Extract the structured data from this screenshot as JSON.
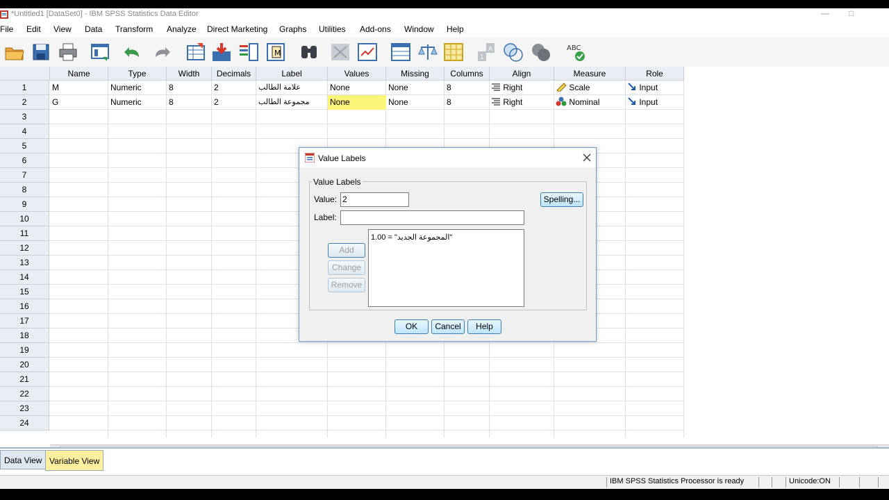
{
  "window": {
    "title": "*Untitled1 [DataSet0] - IBM SPSS Statistics Data Editor"
  },
  "menu": [
    "File",
    "Edit",
    "View",
    "Data",
    "Transform",
    "Analyze",
    "Direct Marketing",
    "Graphs",
    "Utilities",
    "Add-ons",
    "Window",
    "Help"
  ],
  "toolbar": {
    "icons": [
      "open-folder-icon",
      "save-icon",
      "print-icon",
      "dialog-recall-icon",
      "undo-icon",
      "redo-icon",
      "goto-case-icon",
      "goto-variable-icon",
      "variables-icon",
      "run-descriptives-icon",
      "find-icon",
      "insert-cases-icon",
      "insert-variable-icon",
      "split-file-icon",
      "weight-cases-icon",
      "select-cases-icon",
      "value-labels-icon",
      "use-variable-sets-icon",
      "show-all-variables-icon",
      "spell-check-icon"
    ]
  },
  "grid": {
    "columns": [
      "Name",
      "Type",
      "Width",
      "Decimals",
      "Label",
      "Values",
      "Missing",
      "Columns",
      "Align",
      "Measure",
      "Role"
    ],
    "rows": [
      {
        "num": "1",
        "name": "M",
        "type": "Numeric",
        "width": "8",
        "decimals": "2",
        "label": "علامة الطالب",
        "values": "None",
        "missing": "None",
        "columns": "8",
        "align": "Right",
        "measure": "Scale",
        "role": "Input"
      },
      {
        "num": "2",
        "name": "G",
        "type": "Numeric",
        "width": "8",
        "decimals": "2",
        "label": "مجموعة الطالب",
        "values": "None",
        "missing": "None",
        "columns": "8",
        "align": "Right",
        "measure": "Nominal",
        "role": "Input"
      }
    ],
    "row_numbers": [
      "1",
      "2",
      "3",
      "4",
      "5",
      "6",
      "7",
      "8",
      "9",
      "10",
      "11",
      "12",
      "13",
      "14",
      "15",
      "16",
      "17",
      "18",
      "19",
      "20",
      "21",
      "22",
      "23",
      "24"
    ],
    "highlight_color": "#fdf57a"
  },
  "tabs": {
    "data_view": "Data View",
    "variable_view": "Variable View",
    "active_color": "#ffef9f"
  },
  "status": {
    "processor": "IBM SPSS Statistics Processor is ready",
    "unicode": "Unicode:ON"
  },
  "dialog": {
    "title": "Value Labels",
    "group_label": "Value Labels",
    "value_label": "Value:",
    "value": "2",
    "label_label": "Label:",
    "label_value": "",
    "list_items": [
      "1.00 = \"المجموعة الجديد\""
    ],
    "buttons": {
      "spelling": "Spelling...",
      "add": "Add",
      "change": "Change",
      "remove": "Remove",
      "ok": "OK",
      "cancel": "Cancel",
      "help": "Help"
    }
  }
}
